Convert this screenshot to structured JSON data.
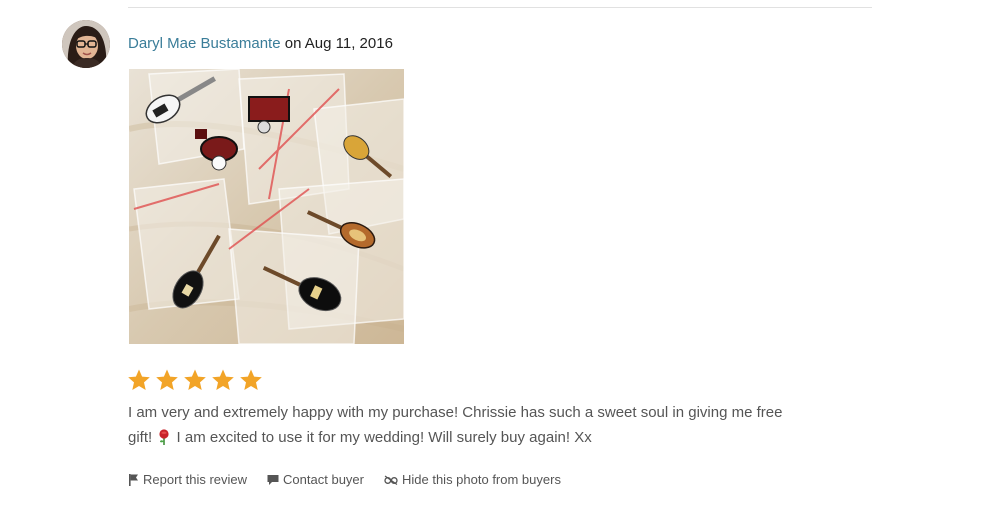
{
  "review": {
    "reviewer_name": "Daryl Mae Bustamante",
    "date_prefix": "on",
    "date": "Aug 11, 2016",
    "rating": 5,
    "rating_max": 5,
    "text_part1": "I am very and extremely happy with my purchase! Chrissie has such a sweet soul in giving me free gift!",
    "text_part2": "I am excited to use it for my wedding! Will surely buy again! Xx"
  },
  "actions": {
    "report": "Report this review",
    "contact": "Contact buyer",
    "hide_photo": "Hide this photo from buyers"
  },
  "colors": {
    "star": "#f2a427",
    "link": "#3a7d99",
    "divider": "#e1e1e1",
    "text": "#555555"
  },
  "icons": {
    "avatar": "avatar",
    "star": "star-icon",
    "rose": "rose-emoji-icon",
    "flag": "flag-icon",
    "message": "message-icon",
    "hide": "hide-eye-icon"
  }
}
